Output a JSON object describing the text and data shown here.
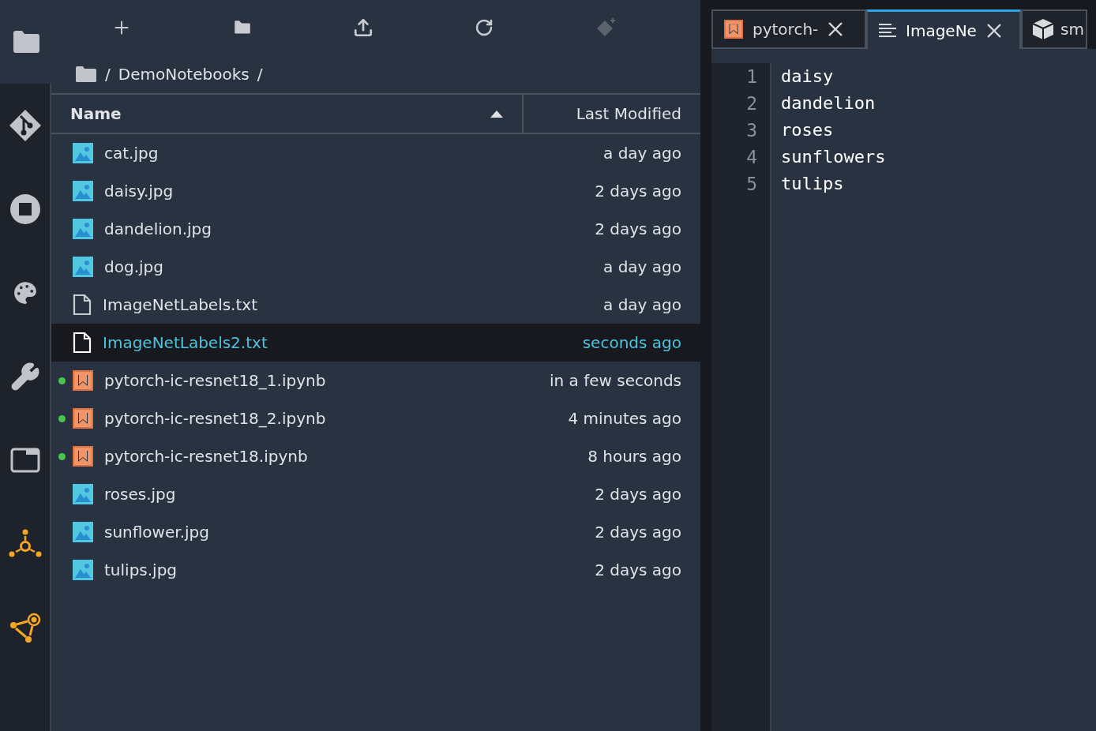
{
  "activity_bar": [
    {
      "selected": true
    },
    {
      "selected": false
    },
    {
      "selected": false
    },
    {
      "selected": false
    },
    {
      "selected": false
    },
    {
      "selected": false
    },
    {
      "selected": false
    },
    {
      "selected": false
    }
  ],
  "toolbar": [
    {
      "disabled": false
    },
    {
      "disabled": false
    },
    {
      "disabled": false
    },
    {
      "disabled": false
    },
    {
      "disabled": true
    }
  ],
  "breadcrumb": {
    "separator_before": "/",
    "folder": "DemoNotebooks",
    "separator_after": "/"
  },
  "file_table": {
    "columns": [
      {
        "label": "Name",
        "sorted": true
      },
      {
        "label": "Last Modified",
        "sorted": false
      }
    ],
    "rows": [
      {
        "kind": "image",
        "name": "cat.jpg",
        "modified": "a day ago",
        "running": false,
        "selected": false
      },
      {
        "kind": "image",
        "name": "daisy.jpg",
        "modified": "2 days ago",
        "running": false,
        "selected": false
      },
      {
        "kind": "image",
        "name": "dandelion.jpg",
        "modified": "2 days ago",
        "running": false,
        "selected": false
      },
      {
        "kind": "image",
        "name": "dog.jpg",
        "modified": "a day ago",
        "running": false,
        "selected": false
      },
      {
        "kind": "text",
        "name": "ImageNetLabels.txt",
        "modified": "a day ago",
        "running": false,
        "selected": false
      },
      {
        "kind": "text",
        "name": "ImageNetLabels2.txt",
        "modified": "seconds ago",
        "running": false,
        "selected": true
      },
      {
        "kind": "notebook",
        "name": "pytorch-ic-resnet18_1.ipynb",
        "modified": "in a few seconds",
        "running": true,
        "selected": false
      },
      {
        "kind": "notebook",
        "name": "pytorch-ic-resnet18_2.ipynb",
        "modified": "4 minutes ago",
        "running": true,
        "selected": false
      },
      {
        "kind": "notebook",
        "name": "pytorch-ic-resnet18.ipynb",
        "modified": "8 hours ago",
        "running": true,
        "selected": false
      },
      {
        "kind": "image",
        "name": "roses.jpg",
        "modified": "2 days ago",
        "running": false,
        "selected": false
      },
      {
        "kind": "image",
        "name": "sunflower.jpg",
        "modified": "2 days ago",
        "running": false,
        "selected": false
      },
      {
        "kind": "image",
        "name": "tulips.jpg",
        "modified": "2 days ago",
        "running": false,
        "selected": false
      }
    ]
  },
  "editor_tabs": [
    {
      "kind": "notebook",
      "label": "pytorch-",
      "closable": true,
      "selected": false
    },
    {
      "kind": "text",
      "label": "ImageNe",
      "closable": true,
      "selected": true
    },
    {
      "kind": "package",
      "label": "sm",
      "closable": false,
      "selected": false
    }
  ],
  "editor": {
    "lines": [
      {
        "number": "1",
        "text": "daisy"
      },
      {
        "number": "2",
        "text": "dandelion"
      },
      {
        "number": "3",
        "text": "roses"
      },
      {
        "number": "4",
        "text": "sunflowers"
      },
      {
        "number": "5",
        "text": "tulips"
      }
    ]
  }
}
